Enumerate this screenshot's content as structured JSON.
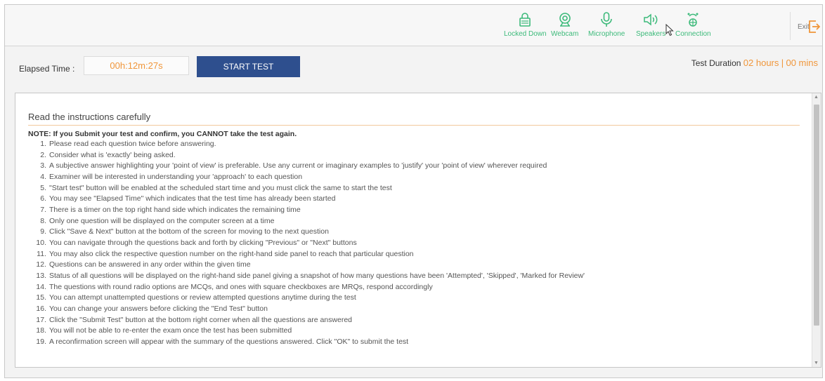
{
  "header": {
    "status_items": [
      {
        "label": "Locked Down",
        "icon": "lock-icon"
      },
      {
        "label": "Webcam",
        "icon": "webcam-icon"
      },
      {
        "label": "Microphone",
        "icon": "microphone-icon"
      },
      {
        "label": "Speakers",
        "icon": "speaker-icon"
      },
      {
        "label": "Connection",
        "icon": "connection-icon"
      }
    ],
    "status_color": "#3cba7a",
    "exit_label": "Exit",
    "exit_color": "#f0963a"
  },
  "timer": {
    "elapsed_label": "Elapsed Time :",
    "elapsed_value": "00h:12m:27s",
    "start_button": "START TEST",
    "duration_label": "Test Duration",
    "duration_hours": "02 hours",
    "duration_sep": "|",
    "duration_mins": "00 mins",
    "accent_color": "#f0963a",
    "button_color": "#2e4f8e"
  },
  "instructions": {
    "heading": "Read the instructions carefully",
    "note": "NOTE: If you Submit your test and confirm, you CANNOT take the test again.",
    "items": [
      "Please read each question twice before answering.",
      "Consider what is 'exactly' being asked.",
      "A subjective answer highlighting your 'point of view' is preferable. Use any current or imaginary examples to 'justify' your 'point of view' wherever required",
      "Examiner will be interested in understanding your 'approach' to each question",
      "\"Start test\" button will be enabled at the scheduled start time and you must click the same to start the test",
      "You may see \"Elapsed Time\" which indicates that the test time has already been started",
      "There is a timer on the top right hand side which indicates the remaining time",
      "Only one question will be displayed on the computer screen at a time",
      "Click \"Save & Next\" button at the bottom of the screen for moving to the next question",
      "You can navigate through the questions back and forth by clicking \"Previous\" or \"Next\" buttons",
      "You may also click the respective question number on the right-hand side panel to reach that particular question",
      "Questions can be answered in any order within the given time",
      "Status of all questions will be displayed on the right-hand side panel giving a snapshot of how many questions have been 'Attempted', 'Skipped', 'Marked for Review'",
      "The questions with round radio options are MCQs, and ones with square checkboxes are MRQs, respond accordingly",
      "You can attempt unattempted questions or review attempted questions anytime during the test",
      "You can change your answers before clicking the \"End Test\" button",
      "Click the \"Submit Test\" button at the bottom right corner when all the questions are answered",
      "You will not be able to re-enter the exam once the test has been submitted",
      "A reconfirmation screen will appear with the summary of the questions answered. Click \"OK\" to submit the test"
    ]
  }
}
